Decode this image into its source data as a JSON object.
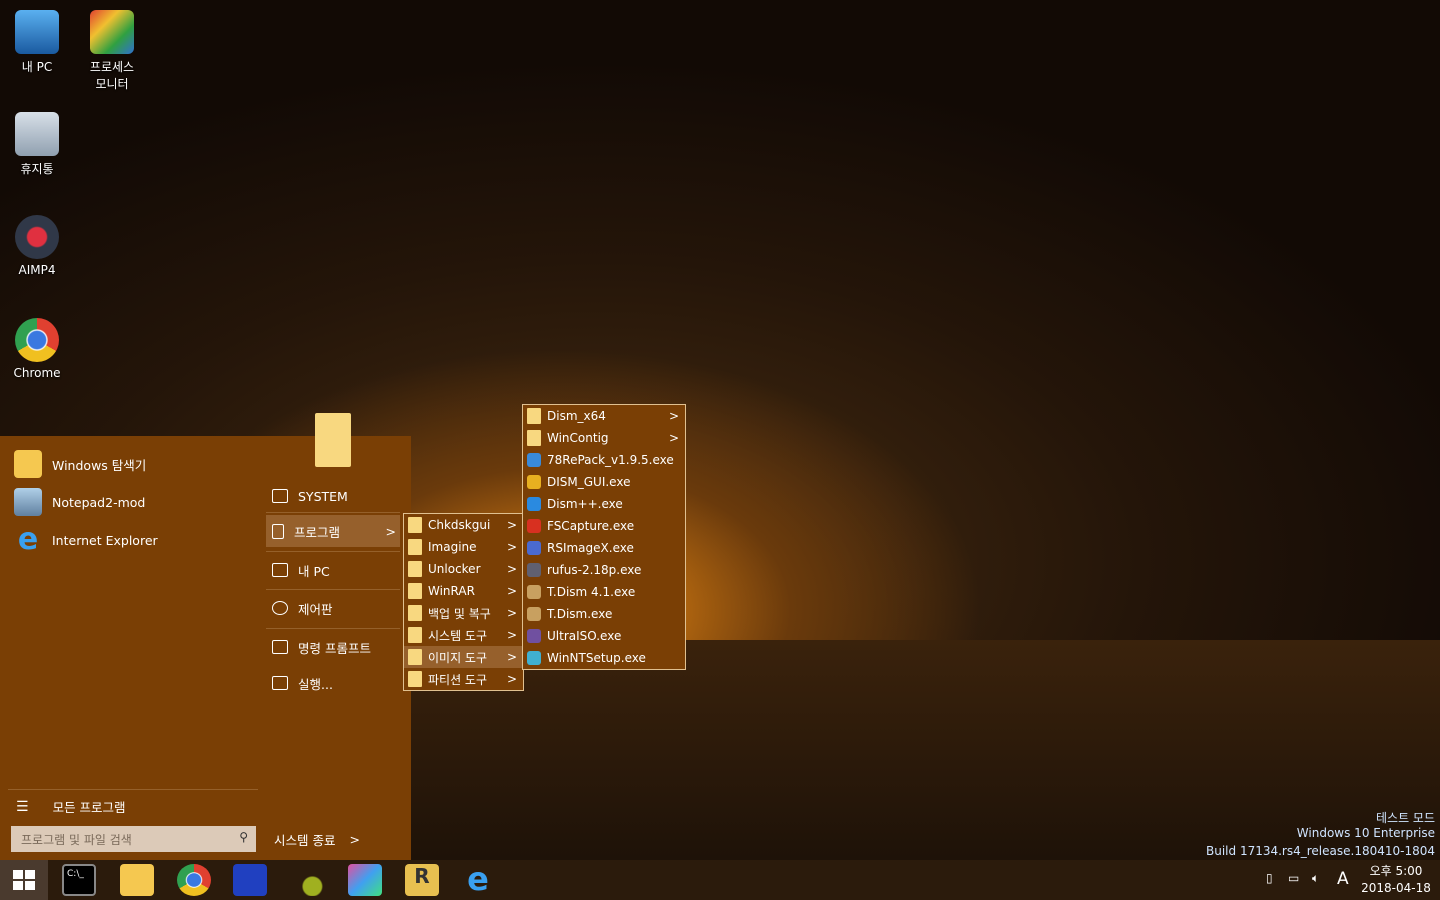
{
  "desktop": {
    "icons": [
      {
        "label": "내 PC"
      },
      {
        "label": "프로세스\n모니터"
      },
      {
        "label": "휴지통"
      },
      {
        "label": "AIMP4"
      },
      {
        "label": "Chrome"
      }
    ],
    "watermark": {
      "mode": "테스트 모드",
      "edition": "Windows 10 Enterprise",
      "build": "Build 17134.rs4_release.180410-1804"
    }
  },
  "start_menu": {
    "pinned": [
      {
        "label": "Windows 탐색기"
      },
      {
        "label": "Notepad2-mod"
      },
      {
        "label": "Internet Explorer"
      }
    ],
    "right": [
      {
        "label": "SYSTEM",
        "icon": "user-folder-icon"
      },
      {
        "label": "프로그램",
        "icon": "document-icon"
      },
      {
        "label": "내 PC",
        "icon": "laptop-icon"
      },
      {
        "label": "제어판",
        "icon": "wrench-icon"
      },
      {
        "label": "명령 프롬프트",
        "icon": "cmd-icon"
      },
      {
        "label": "실행...",
        "icon": "run-icon"
      }
    ],
    "all_programs": "모든 프로그램",
    "search_placeholder": "프로그램 및 파일 검색",
    "shutdown": "시스템 종료"
  },
  "submenu1": {
    "items": [
      "Chkdskgui",
      "Imagine",
      "Unlocker",
      "WinRAR",
      "백업 및 복구",
      "시스템 도구",
      "이미지 도구",
      "파티션 도구"
    ],
    "selected": "이미지 도구"
  },
  "submenu2": {
    "folders": [
      "Dism_x64",
      "WinContig"
    ],
    "files": [
      {
        "label": "78RePack_v1.9.5.exe",
        "color": "#3a8ad8"
      },
      {
        "label": "DISM_GUI.exe",
        "color": "#e8b020"
      },
      {
        "label": "Dism++.exe",
        "color": "#2a8ae0"
      },
      {
        "label": "FSCapture.exe",
        "color": "#d83020"
      },
      {
        "label": "RSImageX.exe",
        "color": "#4a6ad0"
      },
      {
        "label": "rufus-2.18p.exe",
        "color": "#606070"
      },
      {
        "label": "T.Dism 4.1.exe",
        "color": "#c8a060"
      },
      {
        "label": "T.Dism.exe",
        "color": "#c8a060"
      },
      {
        "label": "UltraISO.exe",
        "color": "#7050a0"
      },
      {
        "label": "WinNTSetup.exe",
        "color": "#40b0d0"
      }
    ]
  },
  "taskbar": {
    "apps": [
      "cmd",
      "file-explorer",
      "chrome",
      "save",
      "olive",
      "paint",
      "rar",
      "internet-explorer"
    ],
    "clock": {
      "time": "오후 5:00",
      "date": "2018-04-18"
    },
    "ime": "A"
  }
}
